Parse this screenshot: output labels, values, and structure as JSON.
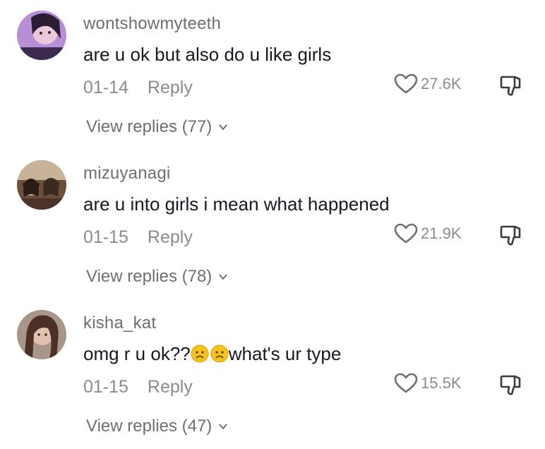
{
  "comments": [
    {
      "username": "wontshowmyteeth",
      "text": "are u ok but also do u like girls",
      "date": "01-14",
      "reply_label": "Reply",
      "likes": "27.6K",
      "view_replies": "View replies (77)"
    },
    {
      "username": "mizuyanagi",
      "text": "are u into girls i mean what happened",
      "date": "01-15",
      "reply_label": "Reply",
      "likes": "21.9K",
      "view_replies": "View replies (78)"
    },
    {
      "username": "kisha_kat",
      "text_prefix": "omg r u ok??",
      "text_suffix": "what's ur type",
      "date": "01-15",
      "reply_label": "Reply",
      "likes": "15.5K",
      "view_replies": "View replies (47)"
    }
  ],
  "icons": {
    "like": "heart-outline-icon",
    "dislike": "thumbs-down-icon",
    "expand": "chevron-down-icon",
    "emoji": "frowning-face-emoji"
  },
  "colors": {
    "text": "#161823",
    "secondary": "#8a8b91",
    "username": "#6e6e73",
    "emoji": "#f6c21c"
  }
}
